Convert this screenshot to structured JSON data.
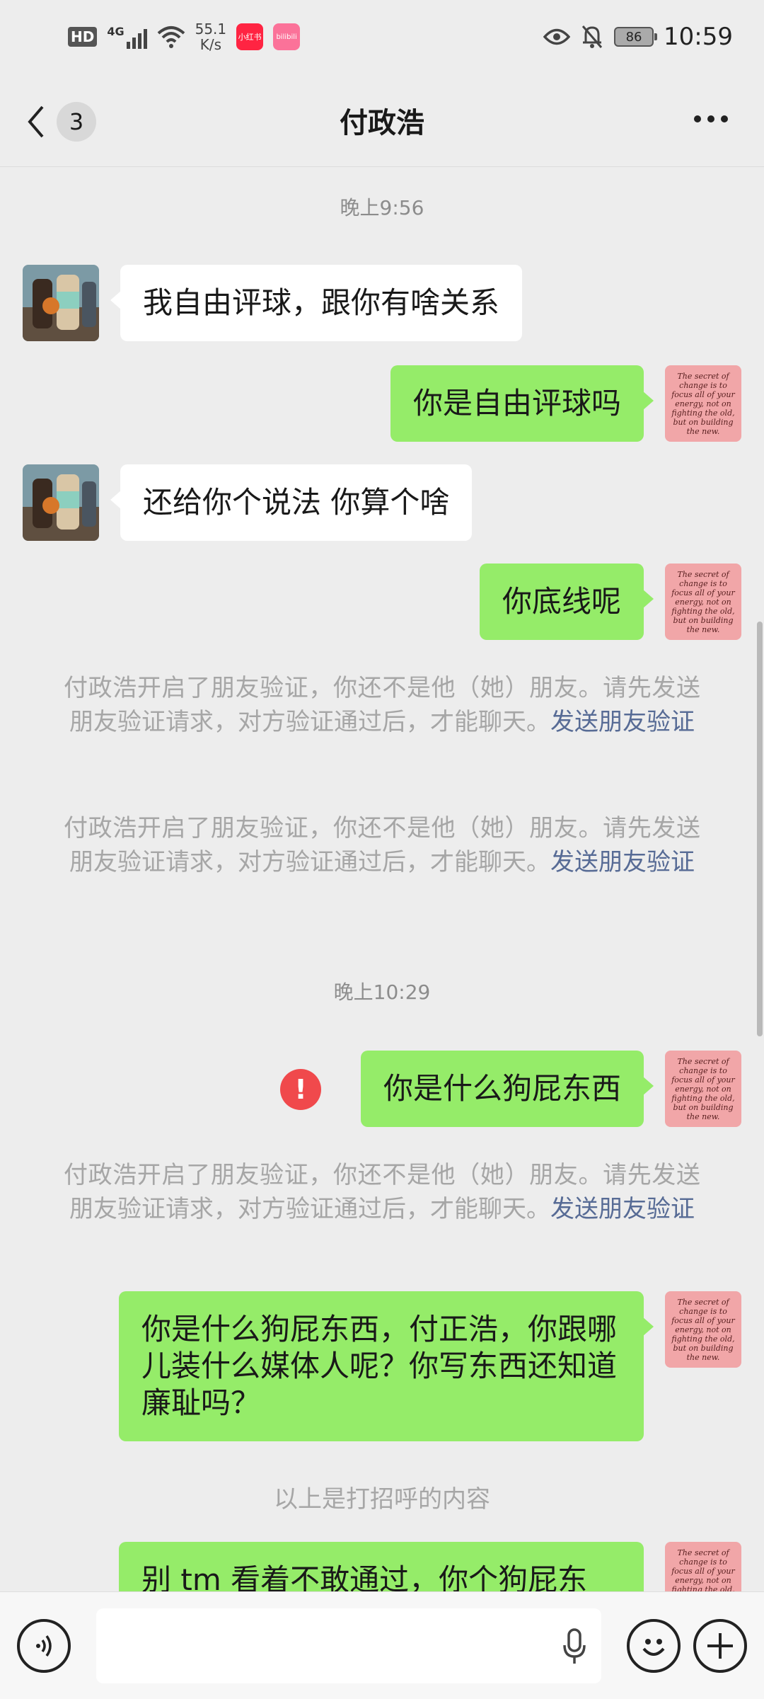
{
  "status_bar": {
    "hd": "HD",
    "network": "4G",
    "speed_value": "55.1",
    "speed_unit": "K/s",
    "app1": "小红书",
    "app2": "bilibili",
    "battery": "86",
    "time": "10:59"
  },
  "nav": {
    "unread_count": "3",
    "title": "付政浩"
  },
  "chat": {
    "time1": "晚上9:56",
    "msg1": "我自由评球，跟你有啥关系",
    "msg2": "你是自由评球吗",
    "msg3": "还给你个说法 你算个啥",
    "msg4": "你底线呢",
    "sys_text": "付政浩开启了朋友验证，你还不是他（她）朋友。请先发送朋友验证请求，对方验证通过后，才能聊天。",
    "sys_link": "发送朋友验证",
    "time2": "晚上10:29",
    "msg5": "你是什么狗屁东西",
    "msg6": "你是什么狗屁东西，付正浩，你跟哪儿装什么媒体人呢？你写东西还知道廉耻吗？",
    "greeting_note": "以上是打招呼的内容",
    "msg7": "别 tm 看着不敢通过，你个狗屁东",
    "my_avatar_quote": "The secret of change is to focus all of your energy, not on fighting the old, but on building the new."
  },
  "input": {
    "placeholder": ""
  },
  "colors": {
    "bubble_me": "#95ec69",
    "bubble_other": "#ffffff",
    "link": "#576b95",
    "fail": "#f0494c"
  }
}
